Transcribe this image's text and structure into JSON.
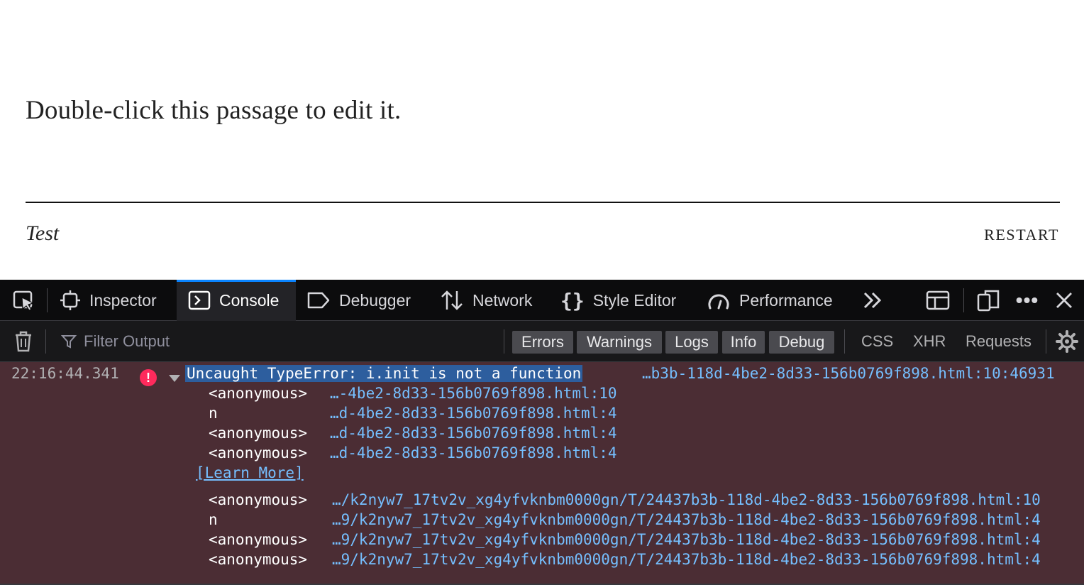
{
  "story": {
    "passage_text": "Double-click this passage to edit it.",
    "title": "Test",
    "restart_label": "RESTART"
  },
  "devtools": {
    "tabs": [
      {
        "label": "Inspector",
        "icon": "inspector-icon"
      },
      {
        "label": "Console",
        "icon": "console-icon",
        "active": true
      },
      {
        "label": "Debugger",
        "icon": "debugger-icon"
      },
      {
        "label": "Network",
        "icon": "network-icon"
      },
      {
        "label": "Style Editor",
        "icon": "style-editor-icon"
      },
      {
        "label": "Performance",
        "icon": "performance-icon"
      }
    ],
    "filter": {
      "placeholder": "Filter Output",
      "levels": [
        "Errors",
        "Warnings",
        "Logs",
        "Info",
        "Debug"
      ],
      "types": [
        "CSS",
        "XHR",
        "Requests"
      ]
    },
    "console": {
      "timestamp": "22:16:44.341",
      "error_message": "Uncaught TypeError: i.init is not a function",
      "error_location": "…b3b-118d-4be2-8d33-156b0769f898.html:10:46931",
      "stack_short": [
        {
          "fn": "<anonymous>",
          "loc": "…-4be2-8d33-156b0769f898.html:10"
        },
        {
          "fn": "n",
          "loc": "…d-4be2-8d33-156b0769f898.html:4"
        },
        {
          "fn": "<anonymous>",
          "loc": "…d-4be2-8d33-156b0769f898.html:4"
        },
        {
          "fn": "<anonymous>",
          "loc": "…d-4be2-8d33-156b0769f898.html:4"
        }
      ],
      "learn_more": "[Learn More]",
      "stack_long": [
        {
          "fn": "<anonymous>",
          "loc": "…/k2nyw7_17tv2v_xg4yfvknbm0000gn/T/24437b3b-118d-4be2-8d33-156b0769f898.html:10"
        },
        {
          "fn": "n",
          "loc": "…9/k2nyw7_17tv2v_xg4yfvknbm0000gn/T/24437b3b-118d-4be2-8d33-156b0769f898.html:4"
        },
        {
          "fn": "<anonymous>",
          "loc": "…9/k2nyw7_17tv2v_xg4yfvknbm0000gn/T/24437b3b-118d-4be2-8d33-156b0769f898.html:4"
        },
        {
          "fn": "<anonymous>",
          "loc": "…9/k2nyw7_17tv2v_xg4yfvknbm0000gn/T/24437b3b-118d-4be2-8d33-156b0769f898.html:4"
        }
      ]
    },
    "colors": {
      "accent": "#0a84ff",
      "error_bg": "#4b2d34",
      "error_icon": "#ff2a5c",
      "link": "#75bfff",
      "selection": "#2d5e9e"
    }
  }
}
